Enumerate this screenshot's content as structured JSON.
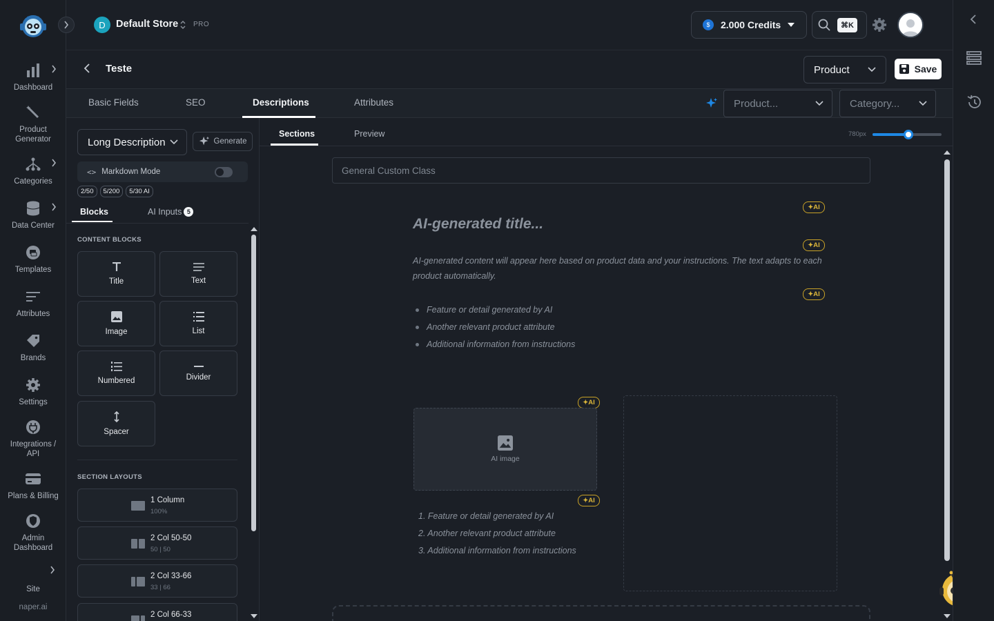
{
  "sidebar": {
    "items": [
      {
        "label": "Dashboard",
        "icon": "bar-chart-icon"
      },
      {
        "label": "Product Generator",
        "icon": "magic-wand-icon"
      },
      {
        "label": "Categories",
        "icon": "hierarchy-icon"
      },
      {
        "label": "Data Center",
        "icon": "database-icon"
      },
      {
        "label": "Templates",
        "icon": "template-icon"
      },
      {
        "label": "Attributes",
        "icon": "attributes-icon"
      },
      {
        "label": "Brands",
        "icon": "tag-icon"
      },
      {
        "label": "Settings",
        "icon": "gear-icon"
      },
      {
        "label": "Integrations / API",
        "icon": "plug-icon"
      },
      {
        "label": "Plans & Billing",
        "icon": "credit-card-icon"
      },
      {
        "label": "Admin Dashboard",
        "icon": "shield-icon"
      }
    ],
    "site_label": "Site",
    "site_url": "naper.ai"
  },
  "topbar": {
    "store_initial": "D",
    "store_name": "Default Store",
    "store_plan": "PRO",
    "credits": "2.000 Credits",
    "search_shortcut": "⌘K"
  },
  "page": {
    "title": "Teste",
    "type_select": "Product",
    "save_label": "Save"
  },
  "tabs": {
    "items": [
      "Basic Fields",
      "SEO",
      "Descriptions",
      "Attributes"
    ],
    "active": "Descriptions",
    "product_placeholder": "Product...",
    "category_placeholder": "Category..."
  },
  "editor": {
    "description_type": "Long Description",
    "generate_label": "Generate",
    "markdown_label": "Markdown Mode",
    "markdown_code": "<>",
    "markdown_enabled": false,
    "counters": [
      "2/50",
      "5/200",
      "5/30 AI"
    ],
    "subtabs": {
      "blocks": "Blocks",
      "ai_inputs": "AI Inputs",
      "ai_inputs_count": "5"
    },
    "content_blocks_heading": "CONTENT BLOCKS",
    "content_blocks": [
      "Title",
      "Text",
      "Image",
      "List",
      "Numbered",
      "Divider",
      "Spacer"
    ],
    "section_layouts_heading": "SECTION LAYOUTS",
    "section_layouts": [
      {
        "name": "1 Column",
        "sub": "100%"
      },
      {
        "name": "2 Col 50-50",
        "sub": "50 | 50"
      },
      {
        "name": "2 Col 33-66",
        "sub": "33 | 66"
      },
      {
        "name": "2 Col 66-33",
        "sub": ""
      }
    ]
  },
  "canvas": {
    "tabs": {
      "sections": "Sections",
      "preview": "Preview"
    },
    "width_label": "780px",
    "width_slider_fraction": 0.52,
    "custom_class_placeholder": "General Custom Class",
    "ai_chip": "AI",
    "ai_title": "AI-generated title...",
    "ai_content": "AI-generated content will appear here based on product data and your instructions. The text adapts to each product automatically.",
    "bullets": [
      "Feature or detail generated by AI",
      "Another relevant product attribute",
      "Additional information from instructions"
    ],
    "image_label": "AI image",
    "numbered": [
      "1. Feature or detail generated by AI",
      "2. Another relevant product attribute",
      "3. Additional information from instructions"
    ]
  },
  "colors": {
    "accent": "#1e88e5",
    "ai_gold": "#c9a227",
    "store_avatar": "#1ba3bd"
  }
}
